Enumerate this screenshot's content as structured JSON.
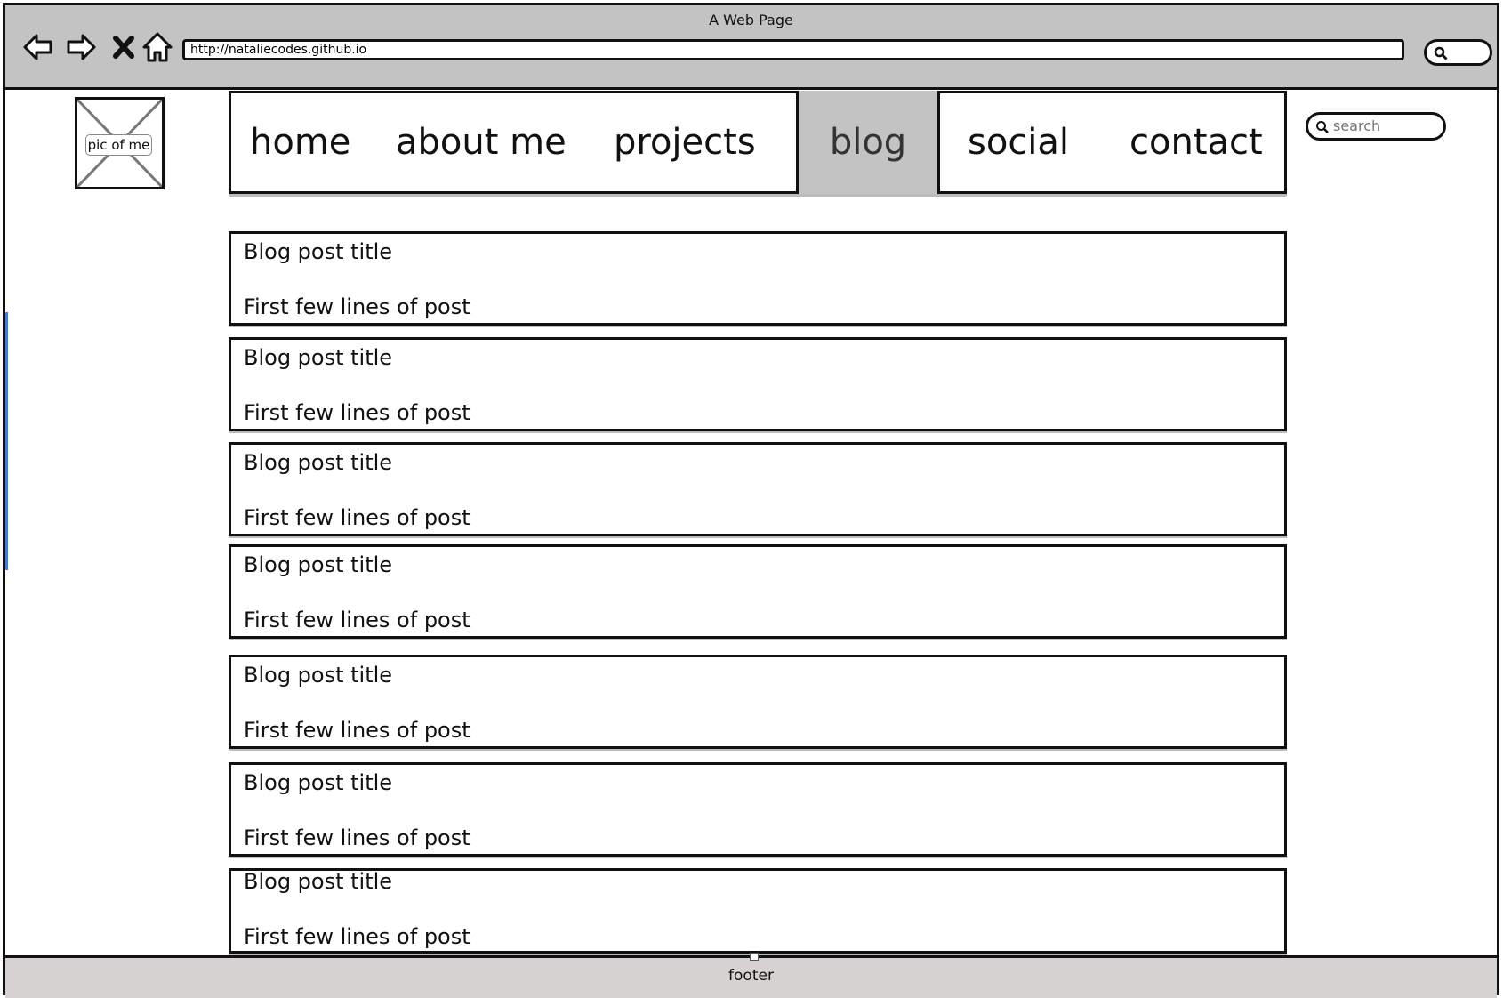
{
  "window": {
    "title": "A Web Page"
  },
  "browser": {
    "url": "http://nataliecodes.github.io",
    "nav_icons": [
      "back-arrow-icon",
      "forward-arrow-icon",
      "close-x-icon",
      "home-icon"
    ],
    "search_icon": "search-icon"
  },
  "profile": {
    "image_label": "pic of me"
  },
  "nav": {
    "items": [
      "home",
      "about me",
      "projects",
      "blog",
      "social",
      "contact"
    ],
    "active": "blog"
  },
  "search": {
    "placeholder": "search"
  },
  "posts": [
    {
      "title": "Blog post title",
      "excerpt": "First few lines of post"
    },
    {
      "title": "Blog post title",
      "excerpt": "First few lines of post"
    },
    {
      "title": "Blog post title",
      "excerpt": "First few lines of post"
    },
    {
      "title": "Blog post title",
      "excerpt": "First few lines of post"
    },
    {
      "title": "Blog post title",
      "excerpt": "First few lines of post"
    },
    {
      "title": "Blog post title",
      "excerpt": "First few lines of post"
    },
    {
      "title": "Blog post title",
      "excerpt": "First few lines of post"
    }
  ],
  "footer": {
    "label": "footer"
  },
  "colors": {
    "chrome": "#c3c3c3",
    "active_tab": "#c3c3c3",
    "footer": "#d7d2d2",
    "accent": "#3b7fd6"
  }
}
